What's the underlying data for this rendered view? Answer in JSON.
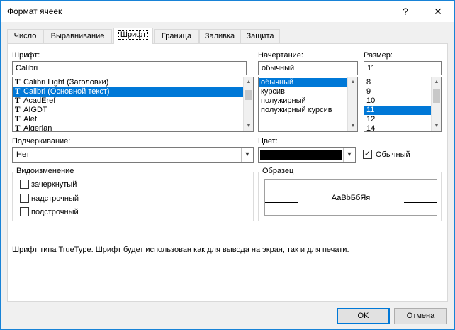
{
  "window": {
    "title": "Формат ячеек",
    "help": "?",
    "close": "✕"
  },
  "tabs": [
    "Число",
    "Выравнивание",
    "Шрифт",
    "Граница",
    "Заливка",
    "Защита"
  ],
  "font": {
    "label": "Шрифт:",
    "value": "Calibri",
    "items": [
      "Calibri Light (Заголовки)",
      "Calibri (Основной текст)",
      "AcadEref",
      "AIGDT",
      "Alef",
      "Algerian"
    ],
    "selected_index": 1
  },
  "style": {
    "label": "Начертание:",
    "value": "обычный",
    "items": [
      "обычный",
      "курсив",
      "полужирный",
      "полужирный курсив"
    ],
    "selected_index": 0
  },
  "size": {
    "label": "Размер:",
    "value": "11",
    "items": [
      "8",
      "9",
      "10",
      "11",
      "12",
      "14"
    ],
    "selected_index": 3
  },
  "underline": {
    "label": "Подчеркивание:",
    "value": "Нет"
  },
  "color": {
    "label": "Цвет:",
    "swatch": "#000000",
    "normal_label": "Обычный",
    "normal_checked": true
  },
  "effects": {
    "label": "Видоизменение",
    "strikethrough": "зачеркнутый",
    "superscript": "надстрочный",
    "subscript": "подстрочный"
  },
  "preview": {
    "label": "Образец",
    "sample": "АаВbБбЯя"
  },
  "note": "Шрифт типа TrueType. Шрифт будет использован как для вывода на экран, так и для печати.",
  "buttons": {
    "ok": "OK",
    "cancel": "Отмена"
  },
  "colors": {
    "selection": "#0078d7",
    "accent": "#1883d7"
  }
}
